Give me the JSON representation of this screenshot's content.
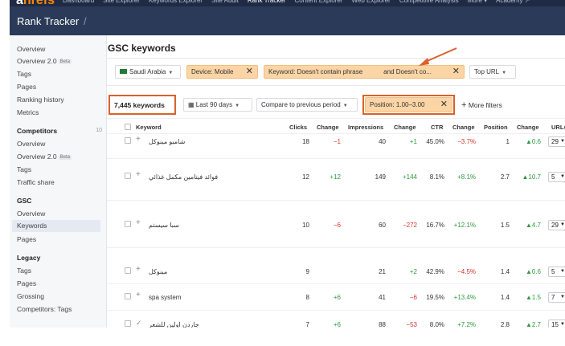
{
  "topnav": {
    "logo_a": "a",
    "logo_rest": "hrefs",
    "items": [
      "Dashboard",
      "Site Explorer",
      "Keywords Explorer",
      "Site Audit",
      "Rank Tracker",
      "Content Explorer",
      "Web Explorer",
      "Competitive Analysis",
      "More ▾",
      "Academy ↗"
    ]
  },
  "header": {
    "title": "Rank Tracker",
    "separator": "/"
  },
  "sidebar": {
    "overview": "Overview",
    "overview2": "Overview 2.0",
    "beta": "Beta",
    "tags": "Tags",
    "pages": "Pages",
    "ranking_history": "Ranking history",
    "metrics": "Metrics",
    "competitors_head": "Competitors",
    "competitors_count": "10",
    "c_overview": "Overview",
    "c_overview2": "Overview 2.0",
    "c_tags": "Tags",
    "c_traffic": "Traffic share",
    "gsc_head": "GSC",
    "g_overview": "Overview",
    "g_keywords": "Keywords",
    "g_pages": "Pages",
    "legacy_head": "Legacy",
    "l_tags": "Tags",
    "l_pages": "Pages",
    "l_grossing": "Grossing",
    "l_comp_tags": "Competitors: Tags"
  },
  "main": {
    "title": "GSC keywords",
    "country": "Saudi Arabia",
    "device": "Device: Mobile",
    "phrase": "Keyword: Doesn't contain phrase",
    "phrase2": "and Doesn't co...",
    "top_url": "Top URL",
    "kw_count": "7,445 keywords",
    "date_range": "Last 90 days",
    "compare": "Compare to previous period",
    "position": "Position: 1.00–3.00",
    "more_filters": "More filters",
    "close": "✕",
    "plus": "+"
  },
  "table": {
    "headers": {
      "keyword": "Keyword",
      "clicks": "Clicks",
      "change1": "Change",
      "impressions": "Impressions",
      "change2": "Change",
      "ctr": "CTR",
      "change3": "Change",
      "position": "Position",
      "change4": "Change",
      "urls": "URLs"
    },
    "rows": [
      {
        "keyword": "شامبو مينوكل",
        "clicks": "18",
        "d_clicks": "−1",
        "impr": "40",
        "d_impr": "+1",
        "ctr": "45.0%",
        "d_ctr": "−3.7%",
        "pos": "1",
        "d_pos": "▲0.6",
        "urls": "29"
      },
      {
        "keyword": "فوائد فيتامين مكمل غذائي",
        "clicks": "12",
        "d_clicks": "+12",
        "impr": "149",
        "d_impr": "+144",
        "ctr": "8.1%",
        "d_ctr": "+8.1%",
        "pos": "2.7",
        "d_pos": "▲10.7",
        "urls": "5"
      },
      {
        "keyword": "سبا سيستم",
        "clicks": "10",
        "d_clicks": "−6",
        "impr": "60",
        "d_impr": "−272",
        "ctr": "16.7%",
        "d_ctr": "+12.1%",
        "pos": "1.5",
        "d_pos": "▲4.7",
        "urls": "29"
      },
      {
        "keyword": "مينوكل",
        "clicks": "9",
        "d_clicks": "",
        "impr": "21",
        "d_impr": "+2",
        "ctr": "42.9%",
        "d_ctr": "−4.5%",
        "pos": "1.4",
        "d_pos": "▲0.6",
        "urls": "5"
      },
      {
        "keyword": "spa system",
        "clicks": "8",
        "d_clicks": "+6",
        "impr": "41",
        "d_impr": "−6",
        "ctr": "19.5%",
        "d_ctr": "+13.4%",
        "pos": "1.4",
        "d_pos": "▲1.5",
        "urls": "7"
      },
      {
        "keyword": "جاردن اولين للشعر",
        "clicks": "7",
        "d_clicks": "+6",
        "impr": "88",
        "d_impr": "−53",
        "ctr": "8.0%",
        "d_ctr": "+7.2%",
        "pos": "2.8",
        "d_pos": "▲2.7",
        "urls": "15"
      }
    ]
  },
  "colors": {
    "accent": "#d9622b",
    "orange_chip": "#fbd5a6",
    "positive": "#2e9a3e",
    "negative": "#d9362b",
    "nav": "#1f2a44"
  }
}
